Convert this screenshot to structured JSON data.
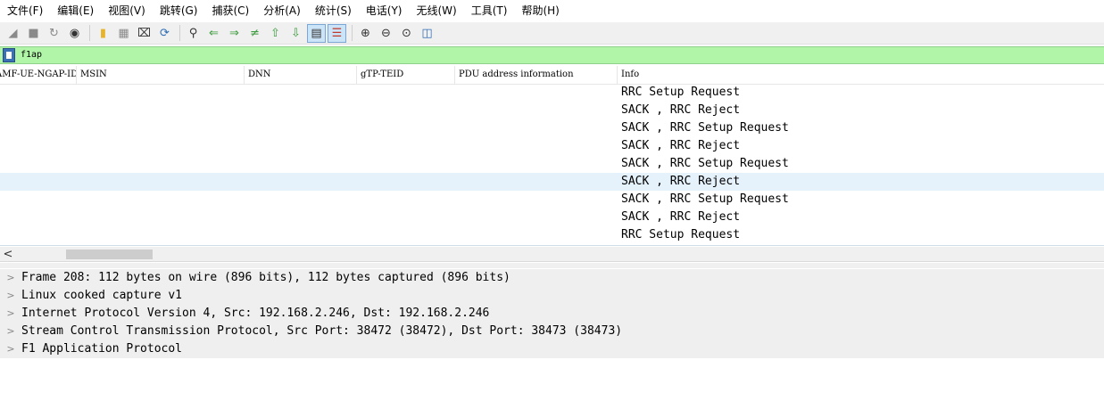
{
  "menu": [
    "文件(F)",
    "编辑(E)",
    "视图(V)",
    "跳转(G)",
    "捕获(C)",
    "分析(A)",
    "统计(S)",
    "电话(Y)",
    "无线(W)",
    "工具(T)",
    "帮助(H)"
  ],
  "toolbar": {
    "icons": [
      "shark-fin-start-icon",
      "stop-capture-icon",
      "restart-capture-icon",
      "capture-options-icon",
      "open-file-icon",
      "save-file-icon",
      "close-file-icon",
      "reload-file-icon",
      "find-packet-icon",
      "go-back-icon",
      "go-forward-icon",
      "go-to-packet-icon",
      "go-first-packet-icon",
      "go-last-packet-icon",
      "autoscroll-icon",
      "colorize-icon",
      "zoom-in-icon",
      "zoom-out-icon",
      "zoom-normal-icon",
      "resize-columns-icon"
    ],
    "active": [
      "autoscroll-icon",
      "colorize-icon"
    ]
  },
  "filter": {
    "value": "f1ap",
    "color": "#b0f5a8"
  },
  "packet_list": {
    "columns": [
      "AMF-UE-NGAP-ID",
      "MSIN",
      "DNN",
      "gTP-TEID",
      "PDU address information",
      "Info"
    ],
    "rows": [
      {
        "info": "RRC Setup Request"
      },
      {
        "info": "SACK , RRC Reject"
      },
      {
        "info": "SACK , RRC Setup Request"
      },
      {
        "info": "SACK , RRC Reject"
      },
      {
        "info": "SACK , RRC Setup Request"
      },
      {
        "info": "SACK , RRC Reject",
        "selected": true
      },
      {
        "info": "SACK , RRC Setup Request"
      },
      {
        "info": "SACK , RRC Reject"
      },
      {
        "info": "RRC Setup Request"
      }
    ],
    "selected_color": "#e5f1fb"
  },
  "scrollbar": {
    "left_arrow": "<"
  },
  "details": {
    "chevron": ">",
    "items": [
      "Frame 208: 112 bytes on wire (896 bits), 112 bytes captured (896 bits)",
      "Linux cooked capture v1",
      "Internet Protocol Version 4, Src: 192.168.2.246, Dst: 192.168.2.246",
      "Stream Control Transmission Protocol, Src Port: 38472 (38472), Dst Port: 38473 (38473)",
      "F1 Application Protocol"
    ]
  }
}
